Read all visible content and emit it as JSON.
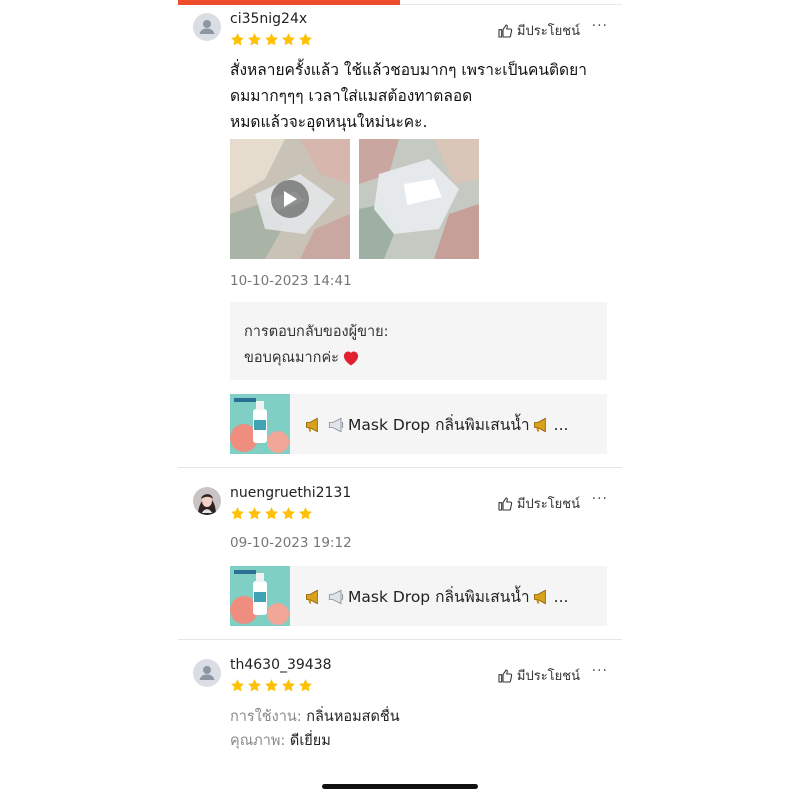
{
  "colors": {
    "accent": "#ee4d2d",
    "star": "#ffc107"
  },
  "reviews": [
    {
      "username": "ci35nig24x",
      "rating": 5,
      "helpful_label": "มีประโยชน์",
      "more_label": "···",
      "text_lines": [
        "สั่งหลายครั้งแล้ว ใช้แล้วชอบมากๆ เพราะเป็นคนติดยา",
        "ดมมากๆๆๆ เวลาใส่แมสต้องทาตลอด",
        "หมดแล้วจะอุดหนุนใหม่นะคะ."
      ],
      "media": [
        {
          "type": "video",
          "icon": "play-icon"
        },
        {
          "type": "image"
        }
      ],
      "date": "10-10-2023 14:41",
      "seller_reply": {
        "title": "การตอบกลับของผู้ขาย:",
        "body": "ขอบคุณมากค่ะ",
        "emoji": "heart-icon"
      },
      "product": {
        "name": "Mask Drop กลิ่นพิมเสนน้ำ",
        "suffix": "..."
      }
    },
    {
      "username": "nuengruethi2131",
      "rating": 5,
      "helpful_label": "มีประโยชน์",
      "more_label": "···",
      "date": "09-10-2023 19:12",
      "product": {
        "name": "Mask Drop กลิ่นพิมเสนน้ำ",
        "suffix": "..."
      }
    },
    {
      "username": "th4630_39438",
      "rating": 5,
      "helpful_label": "มีประโยชน์",
      "more_label": "···",
      "attributes": [
        {
          "label": "การใช้งาน:",
          "value": "กลิ่นหอมสดชื่น"
        },
        {
          "label": "คุณภาพ:",
          "value": "ดีเยี่ยม"
        }
      ]
    }
  ]
}
